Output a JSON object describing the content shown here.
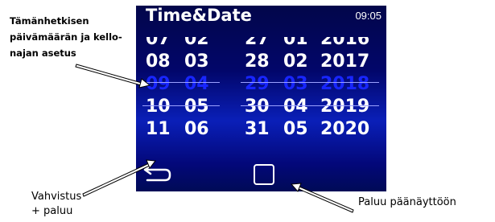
{
  "device_screen": {
    "title": "Time&Date",
    "clock": "09:05",
    "date_picker": {
      "day_column": [
        "07",
        "08",
        "09",
        "10",
        "11"
      ],
      "month_column": [
        "02",
        "03",
        "04",
        "05",
        "06"
      ],
      "right_day_column": [
        "27",
        "28",
        "29",
        "30",
        "31"
      ],
      "right_month_column": [
        "01",
        "02",
        "03",
        "04",
        "05"
      ],
      "year_column": [
        "2016",
        "2017",
        "2018",
        "2019",
        "2020"
      ],
      "selected_index": 2
    },
    "buttons": {
      "back_icon": "return-arrow-icon",
      "home_icon": "square-home-icon"
    },
    "colors": {
      "selected_value": "#1826ff",
      "screen_background": "#02066a",
      "text": "#ffffff"
    }
  },
  "annotations": {
    "current_setting_lines": [
      "Tämänhetkisen",
      "päivämäärän ja kello-",
      "najan asetus"
    ],
    "confirm_back_lines": [
      "Vahvistus",
      "+ paluu"
    ],
    "home_return": "Paluu päänäyttöön"
  }
}
